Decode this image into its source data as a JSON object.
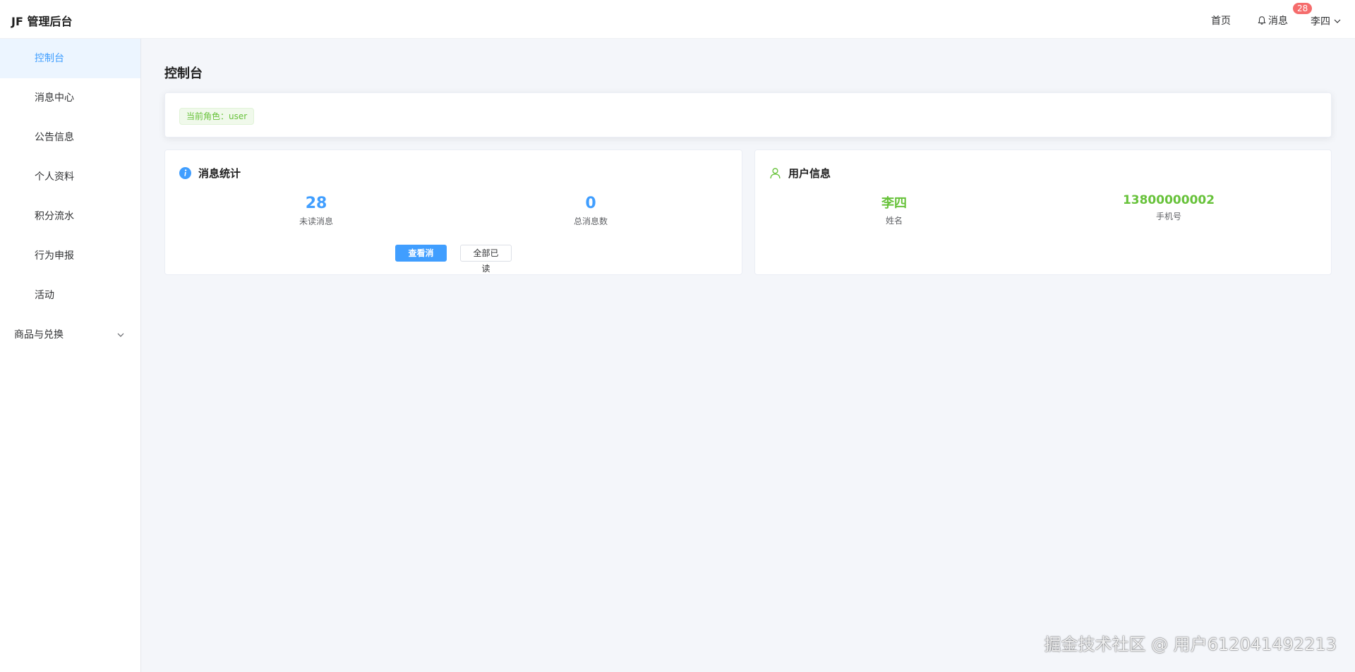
{
  "header": {
    "logo": "JF 管理后台",
    "home": "首页",
    "messages": "消息",
    "badge": "28",
    "user": "李四"
  },
  "sidebar": {
    "items": [
      {
        "label": "控制台",
        "active": true
      },
      {
        "label": "消息中心"
      },
      {
        "label": "公告信息"
      },
      {
        "label": "个人资料"
      },
      {
        "label": "积分流水"
      },
      {
        "label": "行为申报"
      },
      {
        "label": "活动"
      },
      {
        "label": "商品与兑换",
        "has_children": true
      }
    ]
  },
  "main": {
    "title": "控制台",
    "role_tag": "当前角色：user",
    "message_stats": {
      "title": "消息统计",
      "unread": "28",
      "unread_label": "未读消息",
      "total": "0",
      "total_label": "总消息数",
      "view_button": "查看消息",
      "read_all_button": "全部已读"
    },
    "user_info": {
      "title": "用户信息",
      "name": "李四",
      "name_label": "姓名",
      "phone": "13800000002",
      "phone_label": "手机号"
    }
  },
  "watermark": "掘金技术社区 @ 用户612041492213",
  "colors": {
    "primary": "#409eff",
    "success": "#67c23a",
    "danger": "#f56c6c",
    "active_bg": "#ecf5ff"
  }
}
